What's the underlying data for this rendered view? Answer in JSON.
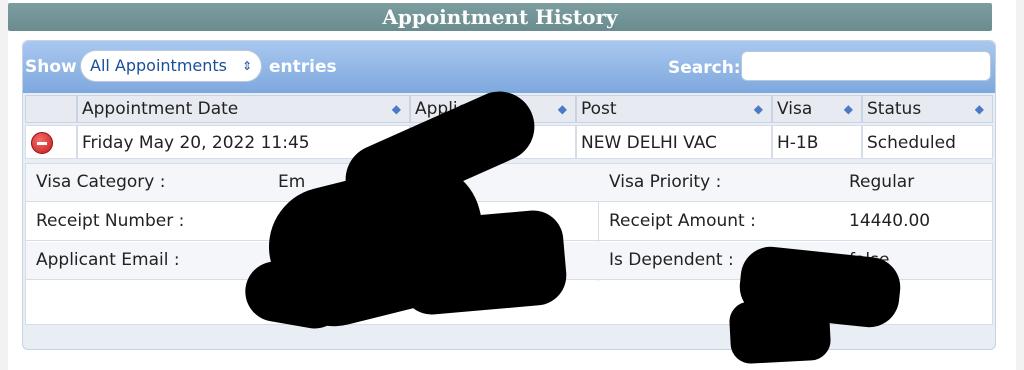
{
  "title": "Appointment History",
  "controls": {
    "show_label": "Show",
    "entries_selected": "All Appointments",
    "entries_label": "entries",
    "search_label": "Search:",
    "search_value": ""
  },
  "table": {
    "columns": [
      "Appointment Date",
      "Applicant",
      "Post",
      "Visa",
      "Status"
    ],
    "row": {
      "appointment_date": "Friday May 20, 2022 11:45",
      "applicant": "",
      "post": "NEW DELHI VAC",
      "visa": "H-1B",
      "status": "Scheduled"
    }
  },
  "details": {
    "visa_category_label": "Visa Category :",
    "visa_category_value": "Em",
    "visa_priority_label": "Visa Priority :",
    "visa_priority_value": "Regular",
    "receipt_number_label": "Receipt Number :",
    "receipt_number_value": "",
    "receipt_amount_label": "Receipt Amount :",
    "receipt_amount_value": "14440.00",
    "applicant_email_label": "Applicant Email :",
    "applicant_email_value": "",
    "is_dependent_label": "Is Dependent :",
    "is_dependent_value": "false"
  }
}
